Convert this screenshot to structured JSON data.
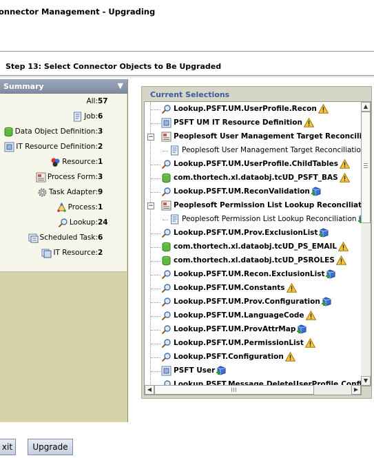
{
  "window": {
    "title": "onnector Management - Upgrading"
  },
  "step": {
    "title": "Step 13: Select Connector Objects to Be Upgraded"
  },
  "summary": {
    "title": "Summary",
    "rows": [
      {
        "label": "All:",
        "value": "57",
        "icon": "none"
      },
      {
        "label": "Job:",
        "value": "6",
        "icon": "job-icon"
      },
      {
        "label": "Data Object Definition:",
        "value": "3",
        "icon": "database-icon"
      },
      {
        "label": "IT Resource Definition:",
        "value": "2",
        "icon": "it-resource-definition-icon"
      },
      {
        "label": "Resource:",
        "value": "1",
        "icon": "resource-icon"
      },
      {
        "label": "Process Form:",
        "value": "3",
        "icon": "process-form-icon"
      },
      {
        "label": "Task Adapter:",
        "value": "9",
        "icon": "gear-icon"
      },
      {
        "label": "Process:",
        "value": "1",
        "icon": "process-icon"
      },
      {
        "label": "Lookup:",
        "value": "24",
        "icon": "lookup-icon"
      },
      {
        "label": "Scheduled Task:",
        "value": "6",
        "icon": "scheduled-task-icon"
      },
      {
        "label": "IT Resource:",
        "value": "2",
        "icon": "it-resource-icon"
      }
    ]
  },
  "selections": {
    "title": "Current Selections",
    "items": [
      {
        "label": "Lookup.PSFT.UM.UserProfile.Recon",
        "icon": "lookup-icon",
        "status": "warning"
      },
      {
        "label": "PSFT UM IT Resource Definition",
        "icon": "it-resource-definition-icon",
        "status": "warning"
      },
      {
        "label": "Peoplesoft User Management Target Reconciliation",
        "icon": "process-form-icon",
        "status": "expander"
      },
      {
        "label": "Peoplesoft User Management Target Reconciliation",
        "icon": "job-icon",
        "status": "child"
      },
      {
        "label": "Lookup.PSFT.UM.UserProfile.ChildTables",
        "icon": "lookup-icon",
        "status": "warning"
      },
      {
        "label": "com.thortech.xl.dataobj.tcUD_PSFT_BAS",
        "icon": "database-icon",
        "status": "warning"
      },
      {
        "label": "Lookup.PSFT.UM.ReconValidation",
        "icon": "lookup-icon",
        "status": "new"
      },
      {
        "label": "Peoplesoft Permission List Lookup Reconciliation",
        "icon": "process-form-icon",
        "status": "expander"
      },
      {
        "label": "Peoplesoft Permission List Lookup Reconciliation",
        "icon": "job-icon",
        "status": "child-new"
      },
      {
        "label": "Lookup.PSFT.UM.Prov.ExclusionList",
        "icon": "lookup-icon",
        "status": "new"
      },
      {
        "label": "com.thortech.xl.dataobj.tcUD_PS_EMAIL",
        "icon": "database-icon",
        "status": "warning"
      },
      {
        "label": "com.thortech.xl.dataobj.tcUD_PSROLES",
        "icon": "database-icon",
        "status": "warning"
      },
      {
        "label": "Lookup.PSFT.UM.Recon.ExclusionList",
        "icon": "lookup-icon",
        "status": "new"
      },
      {
        "label": "Lookup.PSFT.UM.Constants",
        "icon": "lookup-icon",
        "status": "warning"
      },
      {
        "label": "Lookup.PSFT.UM.Prov.Configuration",
        "icon": "lookup-icon",
        "status": "new"
      },
      {
        "label": "Lookup.PSFT.UM.LanguageCode",
        "icon": "lookup-icon",
        "status": "warning"
      },
      {
        "label": "Lookup.PSFT.UM.ProvAttrMap",
        "icon": "lookup-icon",
        "status": "new"
      },
      {
        "label": "Lookup.PSFT.UM.PermissionList",
        "icon": "lookup-icon",
        "status": "warning"
      },
      {
        "label": "Lookup.PSFT.Configuration",
        "icon": "lookup-icon",
        "status": "warning"
      },
      {
        "label": "PSFT User",
        "icon": "it-resource-definition-icon",
        "status": "new"
      },
      {
        "label": "Lookup.PSFT.Message.DeleteUserProfile.Configuration",
        "icon": "lookup-icon",
        "status": "none"
      }
    ]
  },
  "buttons": {
    "exit": "xit",
    "upgrade": "Upgrade"
  }
}
